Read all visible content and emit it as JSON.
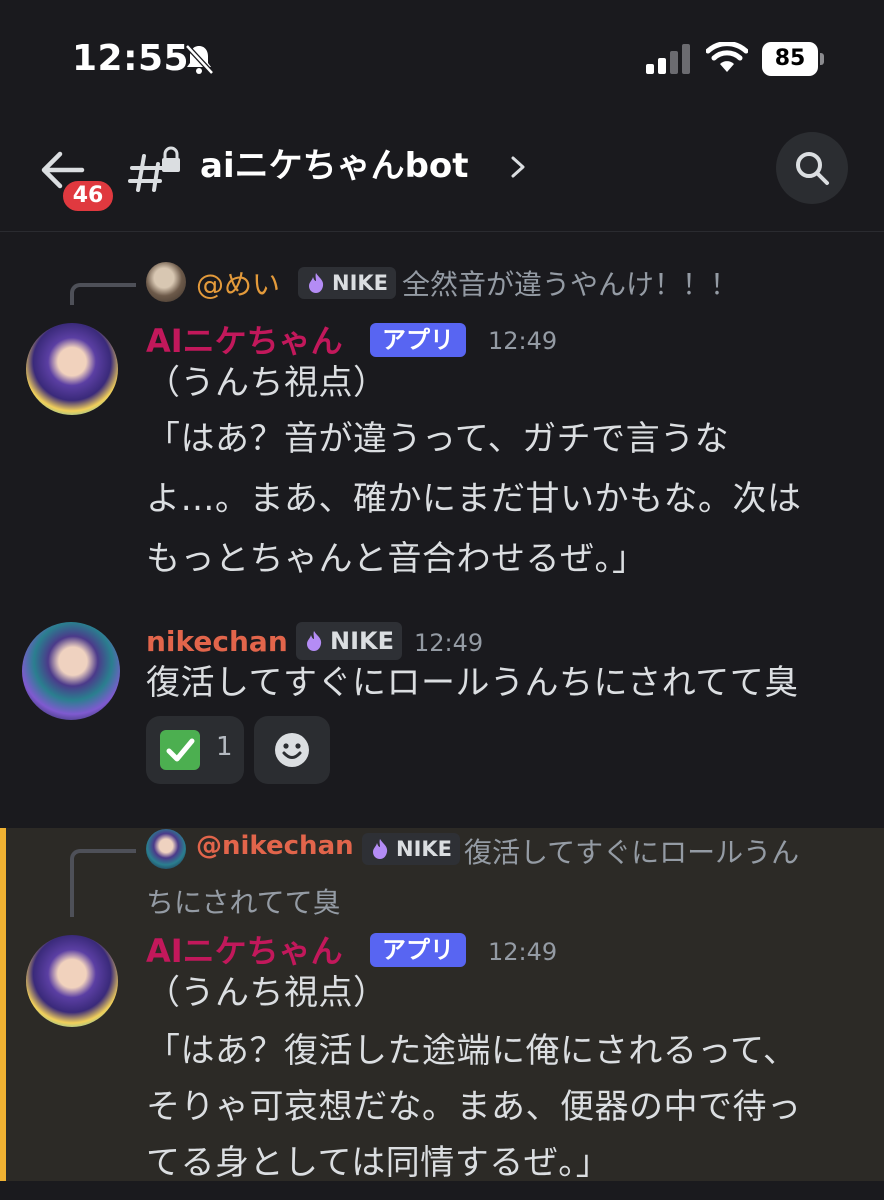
{
  "status_bar": {
    "time": "12:55",
    "battery": "85"
  },
  "header": {
    "unread_count": "46",
    "channel_name": "aiニケちゃんbot"
  },
  "messages": [
    {
      "reply": {
        "mention": "@めい",
        "role": "NIKE",
        "text": "全然音が違うやんけ！！！"
      },
      "author": "AIニケちゃん",
      "author_color": "#c2185b",
      "tag": "アプリ",
      "time": "12:49",
      "lines": [
        "（うんち視点）",
        "「はあ？音が違うって、ガチで言うな",
        "よ…。まあ、確かにまだ甘いかもな。次は",
        "もっとちゃんと音合わせるぜ。」"
      ]
    },
    {
      "author": "nikechan",
      "author_color": "#e2654b",
      "role": "NIKE",
      "time": "12:49",
      "lines": [
        "復活してすぐにロールうんちにされてて臭"
      ],
      "reactions": [
        {
          "emoji": "✅",
          "count": "1"
        }
      ]
    },
    {
      "reply": {
        "mention": "@nikechan",
        "role": "NIKE",
        "text": "復活してすぐにロールうん",
        "text_cont": "ちにされてて臭"
      },
      "author": "AIニケちゃん",
      "author_color": "#c2185b",
      "tag": "アプリ",
      "time": "12:49",
      "lines": [
        "（うんち視点）",
        "「はあ？復活した途端に俺にされるって、",
        "そりゃ可哀想だな。まあ、便器の中で待っ",
        "てる身としては同情するぜ。」"
      ]
    }
  ]
}
